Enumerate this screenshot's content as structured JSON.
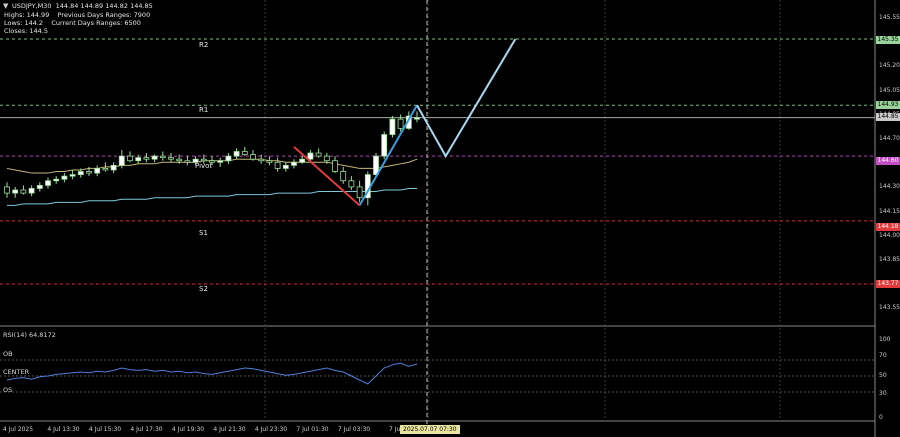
{
  "header": {
    "symbol": "USDJPY,M30",
    "ohlc": "144.84 144.89 144.82 144.85",
    "highs": "Highs: 144.99",
    "prev_range": "Previous Days Ranges: 7900",
    "lows": "Lows: 144.2",
    "curr_range": "Current Days Ranges: 6500",
    "closes": "Closes: 144.5"
  },
  "levels": {
    "r2": {
      "label": "R2",
      "tag": "145.35",
      "price": 145.36,
      "color": "#9ad39a"
    },
    "r1": {
      "label": "R1",
      "tag": "144.93",
      "price": 144.93,
      "color": "#9ad39a"
    },
    "current": {
      "tag": "144.85",
      "price": 144.85,
      "color": "#c9c9c9"
    },
    "pivot": {
      "label": "Pivot",
      "tag": "144.60",
      "price": 144.6,
      "color": "#c14fc1"
    },
    "s1": {
      "label": "S1",
      "tag": "144.18",
      "price": 144.18,
      "color": "#e03a3a"
    },
    "s2": {
      "label": "S2",
      "tag": "143.77",
      "price": 143.77,
      "color": "#e03a3a"
    }
  },
  "price_axis": [
    "145.55",
    "145.40",
    "145.20",
    "145.05",
    "144.85",
    "144.70",
    "144.50",
    "144.30",
    "144.15",
    "144.00",
    "143.85",
    "143.70",
    "143.55"
  ],
  "rsi": {
    "title": "RSI(14) 64.8172",
    "ob": "OB",
    "center": "CENTER",
    "os": "OS",
    "ticks": [
      "100",
      "70",
      "50",
      "30",
      "0"
    ]
  },
  "time_axis": [
    "4 Jul 2025",
    "4 Jul 13:30",
    "4 Jul 15:30",
    "4 Jul 17:30",
    "4 Jul 19:30",
    "4 Jul 21:30",
    "4 Jul 23:30",
    "7 Jul 01:30",
    "7 Jul 03:30",
    "7 Jul"
  ],
  "time_highlight": "2025.07.07 07:30",
  "colors": {
    "bull": "#ffffff",
    "bear": "#000000",
    "candle_wick": "#9adf9a",
    "ma_fast": "#c7b77a",
    "ma_slow": "#7fc8d8",
    "zig_down": "#e03a3a",
    "zig_up": "#3a9ee0",
    "projection": "#a8d8f0",
    "rsi_line": "#4f7fd8"
  },
  "chart_data": {
    "type": "candlestick",
    "candles": [
      [
        144.4,
        144.43,
        144.33,
        144.36
      ],
      [
        144.36,
        144.4,
        144.33,
        144.38
      ],
      [
        144.38,
        144.41,
        144.35,
        144.36
      ],
      [
        144.36,
        144.41,
        144.34,
        144.39
      ],
      [
        144.39,
        144.43,
        144.37,
        144.41
      ],
      [
        144.41,
        144.46,
        144.39,
        144.44
      ],
      [
        144.44,
        144.47,
        144.42,
        144.45
      ],
      [
        144.45,
        144.49,
        144.43,
        144.47
      ],
      [
        144.47,
        144.51,
        144.45,
        144.48
      ],
      [
        144.48,
        144.52,
        144.46,
        144.5
      ],
      [
        144.5,
        144.53,
        144.47,
        144.49
      ],
      [
        144.49,
        144.54,
        144.47,
        144.52
      ],
      [
        144.52,
        144.56,
        144.5,
        144.51
      ],
      [
        144.51,
        144.56,
        144.49,
        144.54
      ],
      [
        144.54,
        144.64,
        144.52,
        144.6
      ],
      [
        144.6,
        144.63,
        144.56,
        144.57
      ],
      [
        144.57,
        144.61,
        144.55,
        144.59
      ],
      [
        144.59,
        144.62,
        144.56,
        144.58
      ],
      [
        144.58,
        144.61,
        144.56,
        144.6
      ],
      [
        144.6,
        144.63,
        144.57,
        144.59
      ],
      [
        144.59,
        144.62,
        144.56,
        144.58
      ],
      [
        144.58,
        144.61,
        144.55,
        144.57
      ],
      [
        144.57,
        144.6,
        144.54,
        144.56
      ],
      [
        144.56,
        144.6,
        144.54,
        144.58
      ],
      [
        144.58,
        144.61,
        144.55,
        144.57
      ],
      [
        144.57,
        144.6,
        144.54,
        144.56
      ],
      [
        144.56,
        144.59,
        144.53,
        144.57
      ],
      [
        144.57,
        144.62,
        144.55,
        144.6
      ],
      [
        144.6,
        144.65,
        144.58,
        144.63
      ],
      [
        144.63,
        144.66,
        144.6,
        144.61
      ],
      [
        144.61,
        144.64,
        144.57,
        144.58
      ],
      [
        144.58,
        144.61,
        144.55,
        144.57
      ],
      [
        144.57,
        144.6,
        144.54,
        144.56
      ],
      [
        144.56,
        144.59,
        144.5,
        144.52
      ],
      [
        144.52,
        144.56,
        144.5,
        144.54
      ],
      [
        144.54,
        144.58,
        144.52,
        144.56
      ],
      [
        144.56,
        144.6,
        144.55,
        144.58
      ],
      [
        144.58,
        144.64,
        144.57,
        144.62
      ],
      [
        144.62,
        144.65,
        144.59,
        144.6
      ],
      [
        144.6,
        144.62,
        144.55,
        144.57
      ],
      [
        144.57,
        144.6,
        144.49,
        144.5
      ],
      [
        144.5,
        144.53,
        144.42,
        144.44
      ],
      [
        144.44,
        144.47,
        144.38,
        144.4
      ],
      [
        144.4,
        144.44,
        144.3,
        144.33
      ],
      [
        144.33,
        144.5,
        144.28,
        144.48
      ],
      [
        144.48,
        144.62,
        144.46,
        144.6
      ],
      [
        144.6,
        144.76,
        144.58,
        144.74
      ],
      [
        144.74,
        144.86,
        144.72,
        144.84
      ],
      [
        144.84,
        144.87,
        144.76,
        144.78
      ],
      [
        144.78,
        144.89,
        144.77,
        144.86
      ],
      [
        144.84,
        144.89,
        144.82,
        144.85
      ]
    ],
    "ma_fast": [
      144.52,
      144.51,
      144.5,
      144.49,
      144.49,
      144.49,
      144.5,
      144.5,
      144.51,
      144.51,
      144.52,
      144.52,
      144.53,
      144.53,
      144.54,
      144.54,
      144.55,
      144.55,
      144.55,
      144.56,
      144.56,
      144.56,
      144.56,
      144.56,
      144.57,
      144.57,
      144.57,
      144.57,
      144.58,
      144.58,
      144.58,
      144.58,
      144.57,
      144.57,
      144.56,
      144.56,
      144.56,
      144.56,
      144.56,
      144.56,
      144.55,
      144.54,
      144.53,
      144.52,
      144.52,
      144.52,
      144.53,
      144.54,
      144.55,
      144.56,
      144.58
    ],
    "ma_slow": [
      144.28,
      144.28,
      144.29,
      144.29,
      144.29,
      144.29,
      144.3,
      144.3,
      144.3,
      144.3,
      144.31,
      144.31,
      144.31,
      144.31,
      144.32,
      144.32,
      144.32,
      144.32,
      144.33,
      144.33,
      144.33,
      144.33,
      144.33,
      144.34,
      144.34,
      144.34,
      144.34,
      144.34,
      144.35,
      144.35,
      144.35,
      144.35,
      144.35,
      144.36,
      144.36,
      144.36,
      144.36,
      144.36,
      144.37,
      144.37,
      144.37,
      144.37,
      144.37,
      144.37,
      144.37,
      144.37,
      144.38,
      144.38,
      144.38,
      144.39,
      144.39
    ],
    "zigzag_down": [
      [
        35,
        144.66
      ],
      [
        43,
        144.28
      ]
    ],
    "zigzag_up": [
      [
        43,
        144.28
      ],
      [
        50,
        144.93
      ]
    ],
    "projection": [
      [
        50,
        144.93
      ],
      [
        53.5,
        144.6
      ],
      [
        62,
        145.36
      ]
    ],
    "rsi_values": [
      45,
      47,
      48,
      46,
      49,
      50,
      52,
      53,
      54,
      55,
      54,
      56,
      55,
      57,
      60,
      58,
      57,
      58,
      56,
      57,
      55,
      56,
      54,
      55,
      53,
      52,
      54,
      56,
      58,
      60,
      59,
      57,
      55,
      53,
      51,
      52,
      54,
      56,
      58,
      60,
      57,
      55,
      50,
      45,
      40,
      50,
      60,
      64,
      66,
      62,
      65
    ]
  }
}
